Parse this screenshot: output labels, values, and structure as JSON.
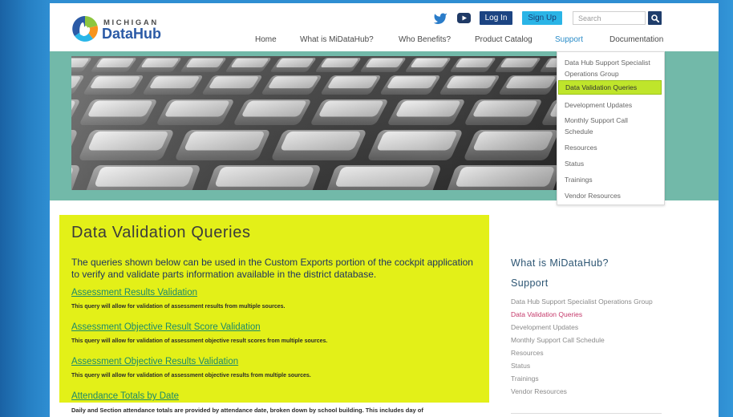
{
  "logo": {
    "state": "MICHIGAN",
    "name": "DataHub",
    "icon": "michigan-datahub-logo-icon"
  },
  "header": {
    "social": [
      {
        "icon": "twitter-icon"
      },
      {
        "icon": "youtube-icon"
      }
    ],
    "login_label": "Log In",
    "signup_label": "Sign Up",
    "search_placeholder": "Search",
    "search_icon": "search-icon"
  },
  "nav": {
    "items": [
      {
        "label": "Home"
      },
      {
        "label": "What is MiDataHub?"
      },
      {
        "label": "Who Benefits?"
      },
      {
        "label": "Product Catalog"
      },
      {
        "label": "Support",
        "active": true
      },
      {
        "label": "Documentation"
      }
    ]
  },
  "support_menu": {
    "items": [
      {
        "label": "Data Hub Support Specialist Operations Group"
      },
      {
        "label": "Data Validation Queries",
        "highlighted": true
      },
      {
        "label": "Development Updates"
      },
      {
        "label": "Monthly Support Call Schedule"
      },
      {
        "label": "Resources"
      },
      {
        "label": "Status"
      },
      {
        "label": "Trainings"
      },
      {
        "label": "Vendor Resources"
      }
    ]
  },
  "main": {
    "title": "Data Validation Queries",
    "intro": "The queries shown below can be used in the Custom Exports portion of the cockpit application to verify and validate parts information available in the district database.",
    "queries": [
      {
        "title": "Assessment Results Validation",
        "description": "This query will allow for validation of assessment results from multiple sources."
      },
      {
        "title": "Assessment Objective Result Score Validation",
        "description": "This query will allow for validation of assessment objective result scores from multiple sources."
      },
      {
        "title": "Assessment Objective Results Validation",
        "description": "This query will allow for validation of assessment objective results from multiple sources."
      },
      {
        "title": "Attendance Totals by Date",
        "description": "Daily and Section attendance totals are provided by attendance date, broken down by school building. This includes day of"
      }
    ]
  },
  "sidebar": {
    "heading": "What is MiDataHub?",
    "section": "Support",
    "items": [
      {
        "label": "Data Hub Support Specialist Operations Group"
      },
      {
        "label": "Data Validation Queries",
        "active": true
      },
      {
        "label": "Development Updates"
      },
      {
        "label": "Monthly Support Call Schedule"
      },
      {
        "label": "Resources"
      },
      {
        "label": "Status"
      },
      {
        "label": "Trainings"
      },
      {
        "label": "Vendor Resources"
      }
    ]
  },
  "colors": {
    "hero_band": "#72b9a9",
    "highlight": "#e3f018",
    "menu_highlight": "#bfe52b",
    "link": "#1c896b",
    "nav_active": "#2a8cc8",
    "sidebar_active": "#c53a6b",
    "brand_blue": "#2b5aa6",
    "login_button": "#1c4482",
    "signup_button": "#2ab4e6",
    "search_button": "#1f3d6b",
    "heading": "#2c5573"
  }
}
